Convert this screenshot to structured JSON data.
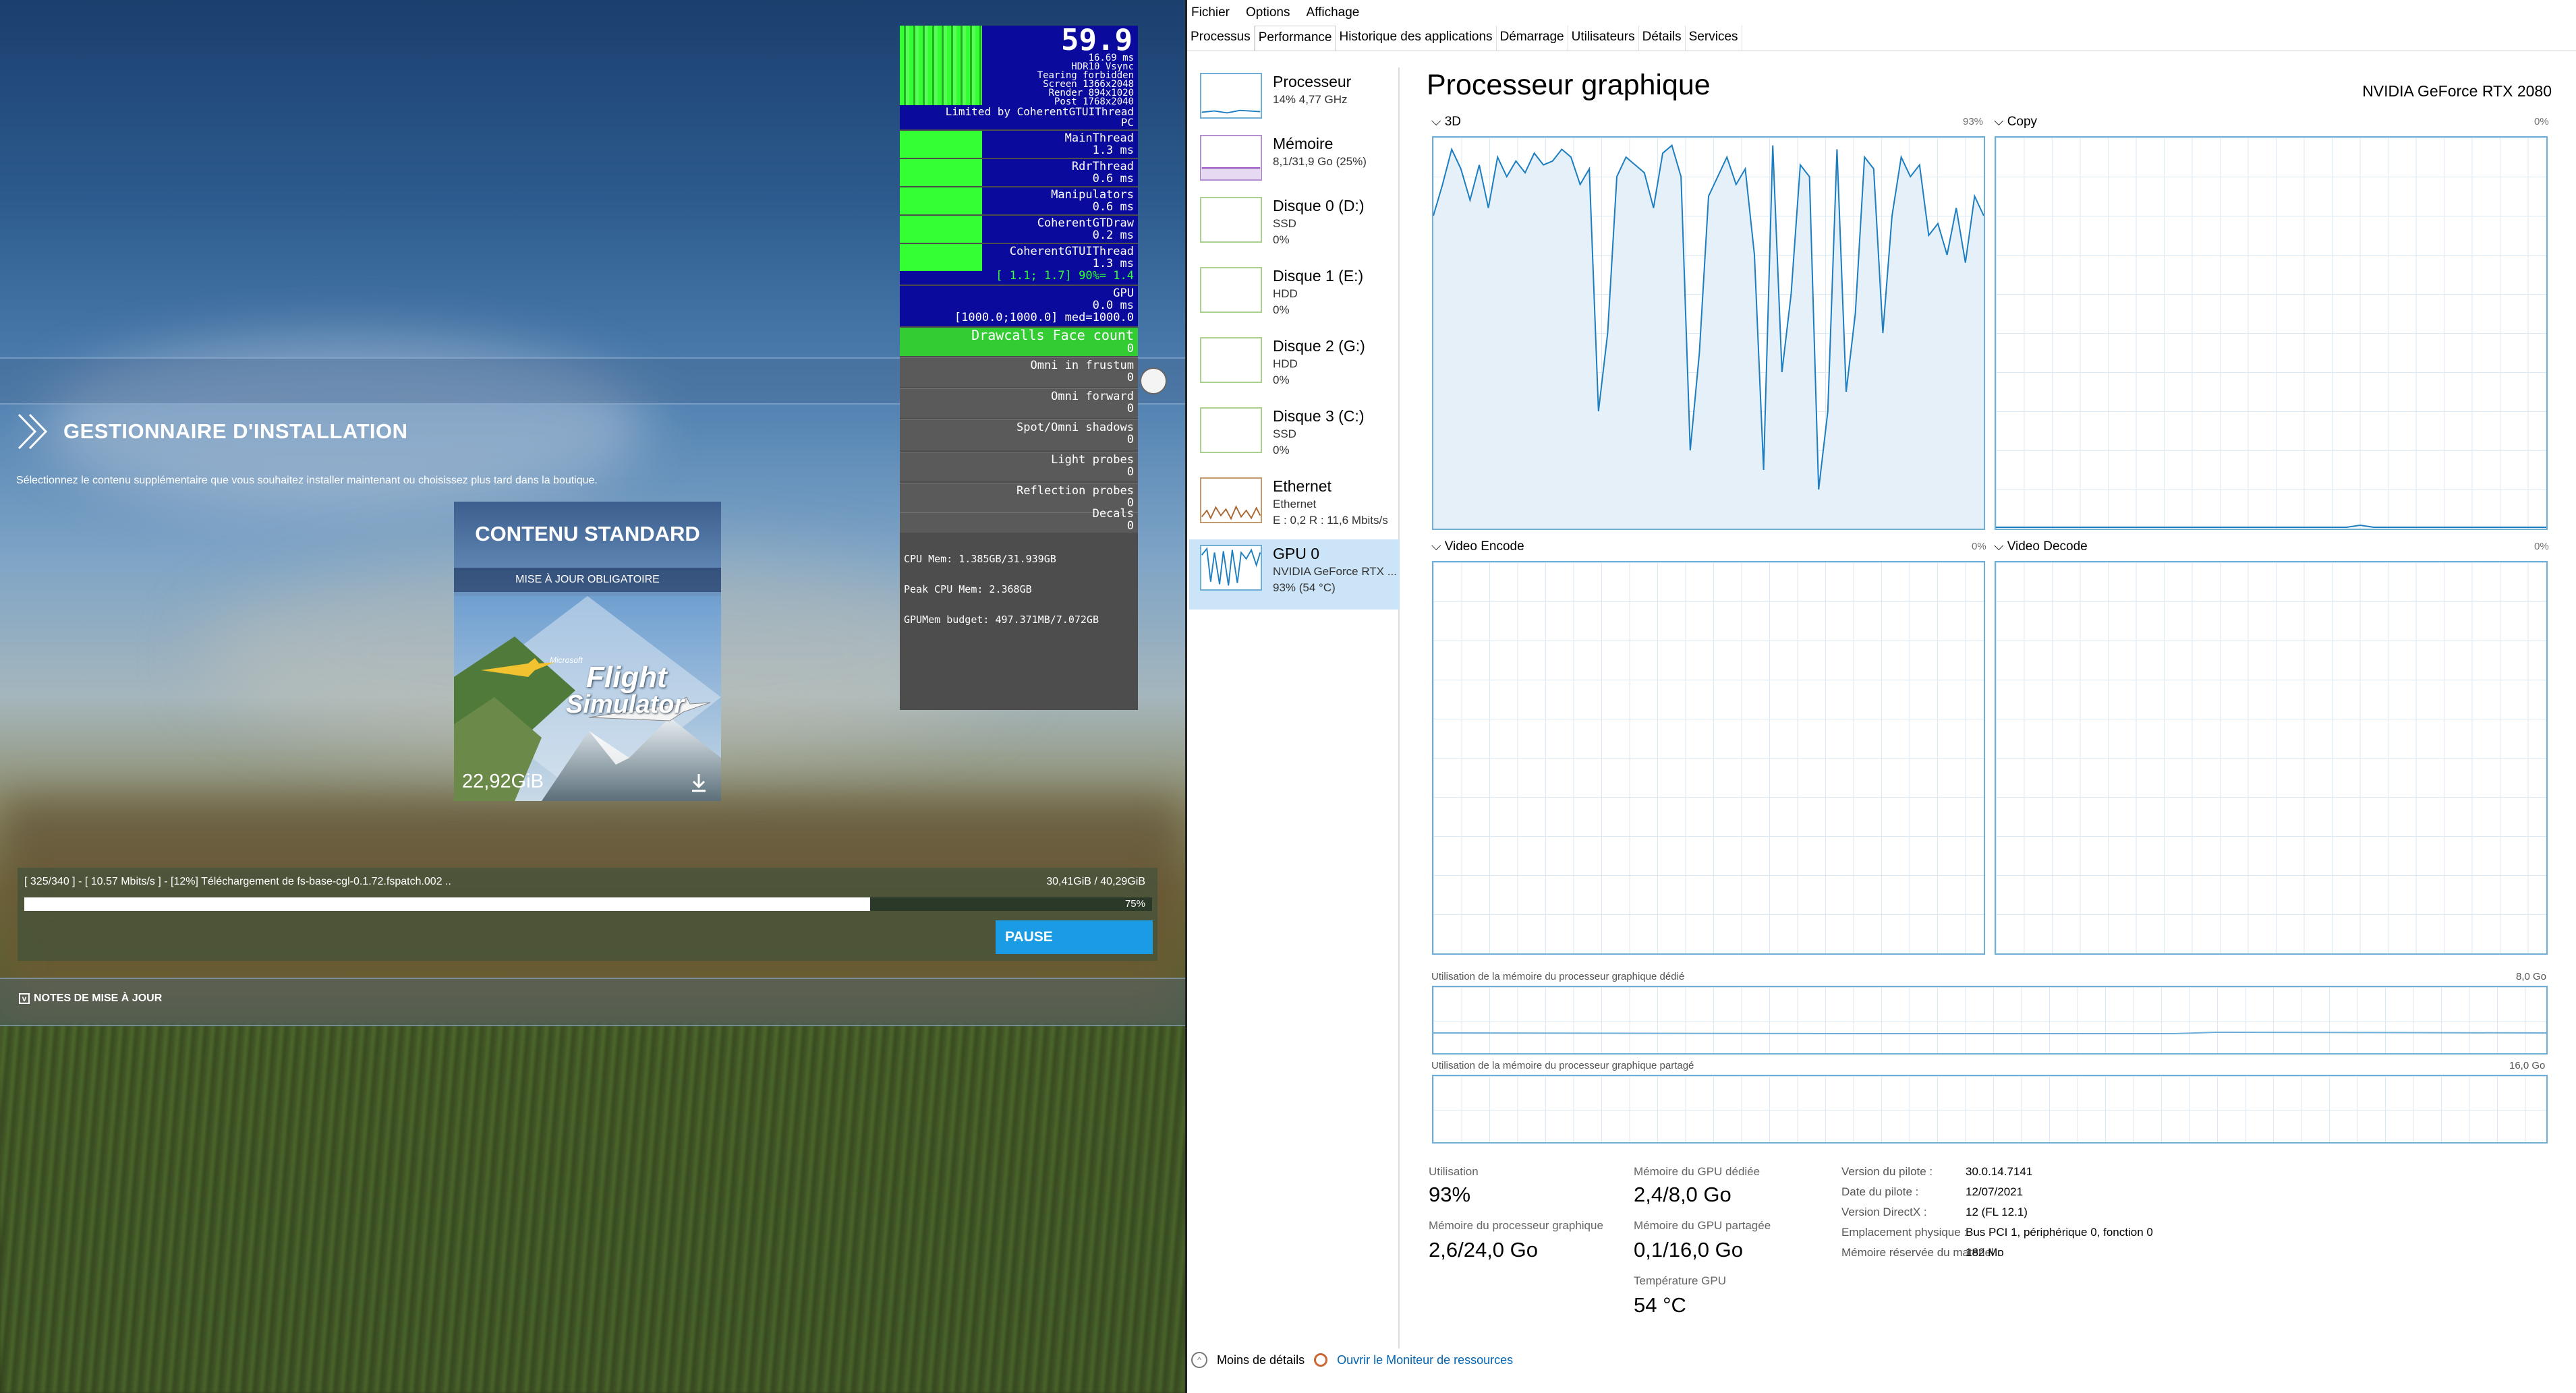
{
  "game": {
    "title": "GESTIONNAIRE D'INSTALLATION",
    "subtitle": "Sélectionnez le contenu supplémentaire que vous souhaitez installer maintenant ou choisissez plus tard dans la boutique.",
    "card": {
      "title": "CONTENU STANDARD",
      "badge": "MISE À JOUR OBLIGATOIRE",
      "logo_small": "Microsoft",
      "logo_line1": "Flight",
      "logo_line2": "Simulator",
      "size": "22,92GiB"
    },
    "download": {
      "status": "[ 325/340 ] - [ 10.57 Mbits/s ] - [12%] Téléchargement de fs-base-cgl-0.1.72.fspatch.002 ..",
      "size": "30,41GiB / 40,29GiB",
      "percent_label": "75%",
      "progress": 0.75,
      "pause_label": "PAUSE"
    },
    "notes_label": "NOTES DE MISE À JOUR"
  },
  "debug": {
    "fps": "59.9",
    "lines": [
      "16.69 ms",
      "HDR10 Vsync",
      "Tearing forbidden",
      "Screen 1366x2048",
      "Render 894x1020",
      "Post 1768x2040"
    ],
    "limited": "Limited by CoherentGTUIThread",
    "pc": "PC",
    "rows": [
      {
        "name": "MainThread",
        "val": "1.3 ms"
      },
      {
        "name": "RdrThread",
        "val": "0.6 ms"
      },
      {
        "name": "Manipulators",
        "val": "0.6 ms"
      },
      {
        "name": "CoherentGTDraw",
        "val": "0.2 ms"
      },
      {
        "name": "CoherentGTUIThread",
        "val": "1.3 ms"
      }
    ],
    "range1": "[ 1.1; 1.7] 90%= 1.4",
    "gpu_label": "GPU",
    "gpu_val": "0.0 ms",
    "range2": "[1000.0;1000.0] med=1000.0",
    "drawcalls": "Drawcalls Face count",
    "drawcalls_val": "0",
    "grey_rows": [
      {
        "name": "Omni in frustum",
        "val": "0"
      },
      {
        "name": "Omni forward",
        "val": "0"
      },
      {
        "name": "Spot/Omni shadows",
        "val": "0"
      },
      {
        "name": "Light probes",
        "val": "0"
      },
      {
        "name": "Reflection probes",
        "val": "0"
      },
      {
        "name": "Decals",
        "val": "0"
      }
    ],
    "mem1": "CPU Mem: 1.385GB/31.939GB",
    "mem2": "Peak CPU Mem: 2.368GB",
    "mem3": "GPUMem budget: 497.371MB/7.072GB"
  },
  "taskmanager": {
    "menu": [
      "Fichier",
      "Options",
      "Affichage"
    ],
    "tabs": [
      "Processus",
      "Performance",
      "Historique des applications",
      "Démarrage",
      "Utilisateurs",
      "Détails",
      "Services"
    ],
    "active_tab": "Performance",
    "sidebar": [
      {
        "name": "Processeur",
        "d1": "14% 4,77 GHz",
        "d2": ""
      },
      {
        "name": "Mémoire",
        "d1": "8,1/31,9 Go (25%)",
        "d2": ""
      },
      {
        "name": "Disque 0 (D:)",
        "d1": "SSD",
        "d2": "0%"
      },
      {
        "name": "Disque 1 (E:)",
        "d1": "HDD",
        "d2": "0%"
      },
      {
        "name": "Disque 2 (G:)",
        "d1": "HDD",
        "d2": "0%"
      },
      {
        "name": "Disque 3 (C:)",
        "d1": "SSD",
        "d2": "0%"
      },
      {
        "name": "Ethernet",
        "d1": "Ethernet",
        "d2": "E : 0,2  R : 11,6 Mbits/s"
      },
      {
        "name": "GPU 0",
        "d1": "NVIDIA GeForce RTX ...",
        "d2": "93% (54 °C)"
      }
    ],
    "title": "Processeur graphique",
    "gpu_name": "NVIDIA GeForce RTX 2080",
    "graphs": {
      "g3d": {
        "label": "3D",
        "pct": "93%"
      },
      "copy": {
        "label": "Copy",
        "pct": "0%"
      },
      "venc": {
        "label": "Video Encode",
        "pct": "0%"
      },
      "vdec": {
        "label": "Video Decode",
        "pct": "0%"
      }
    },
    "dedicated_label": "Utilisation de la mémoire du processeur graphique dédié",
    "dedicated_max": "8,0 Go",
    "shared_label": "Utilisation de la mémoire du processeur graphique partagé",
    "shared_max": "16,0 Go",
    "stats": {
      "util_l": "Utilisation",
      "util_v": "93%",
      "gpumem_l": "Mémoire du processeur graphique",
      "gpumem_v": "2,6/24,0 Go",
      "ded_l": "Mémoire du GPU dédiée",
      "ded_v": "2,4/8,0 Go",
      "shr_l": "Mémoire du GPU partagée",
      "shr_v": "0,1/16,0 Go",
      "temp_l": "Température GPU",
      "temp_v": "54 °C"
    },
    "details": [
      {
        "k": "Version du pilote :",
        "v": "30.0.14.7141"
      },
      {
        "k": "Date du pilote :",
        "v": "12/07/2021"
      },
      {
        "k": "Version DirectX :",
        "v": "12 (FL 12.1)"
      },
      {
        "k": "Emplacement physique :",
        "v": "Bus PCI 1, périphérique 0, fonction 0"
      },
      {
        "k": "Mémoire réservée du matériel :",
        "v": "182 Mo"
      }
    ],
    "footer_less": "Moins de détails",
    "footer_monitor": "Ouvrir le Moniteur de ressources"
  },
  "chart_data": {
    "type": "area",
    "title": "3D",
    "ylim": [
      0,
      100
    ],
    "values": [
      80,
      88,
      97,
      92,
      84,
      93,
      82,
      95,
      90,
      94,
      91,
      96,
      93,
      94,
      97,
      95,
      88,
      92,
      30,
      50,
      90,
      95,
      93,
      91,
      82,
      96,
      98,
      90,
      20,
      45,
      85,
      90,
      95,
      88,
      92,
      70,
      15,
      98,
      40,
      60,
      93,
      90,
      10,
      30,
      97,
      35,
      55,
      95,
      92,
      50,
      80,
      95,
      90,
      93,
      75,
      78,
      70,
      82,
      68,
      85,
      80
    ]
  },
  "colors": {
    "accent": "#1a9be3",
    "graph_border": "#6faed7",
    "selected": "#cce4f7",
    "debug_blue": "#0a0a9c",
    "debug_green": "#33ff33"
  }
}
